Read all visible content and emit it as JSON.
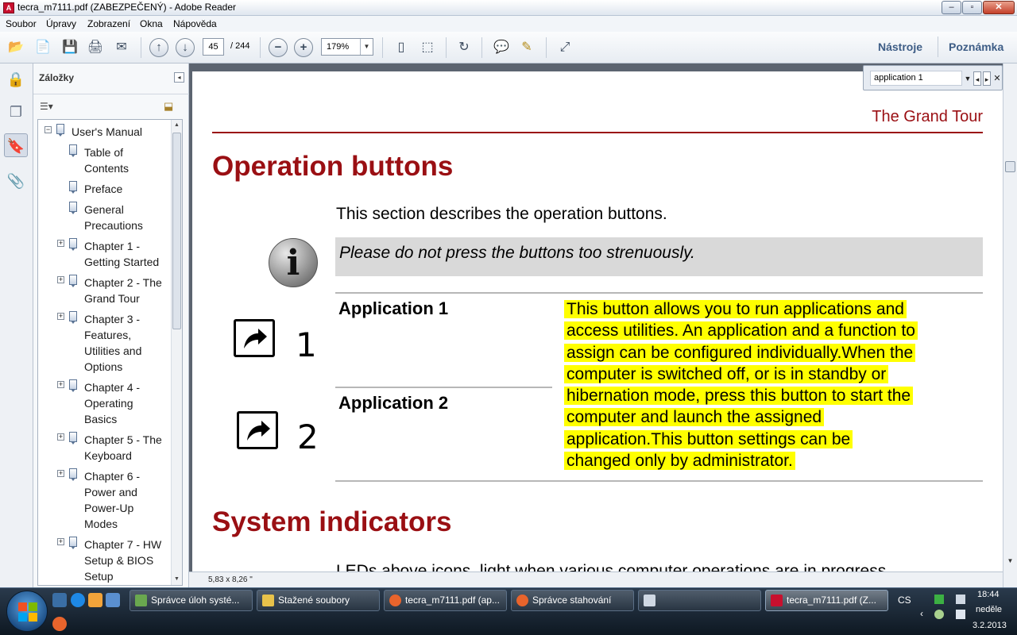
{
  "window": {
    "title": "tecra_m7111.pdf (ZABEZPEČENÝ) - Adobe Reader",
    "min": "–",
    "max": "▫",
    "close": "✕"
  },
  "menu": [
    "Soubor",
    "Úpravy",
    "Zobrazení",
    "Okna",
    "Nápověda"
  ],
  "toolbar": {
    "page_current": "45",
    "page_total": "/ 244",
    "zoom": "179%",
    "tools_label": "Nástroje",
    "comment_label": "Poznámka"
  },
  "bookmarks": {
    "title": "Záložky",
    "items": [
      "User's Manual",
      "Table of",
      "Contents",
      "Preface",
      "General",
      "Precautions",
      "Chapter 1 -",
      "Getting Started",
      "Chapter 2 - The",
      "Grand Tour",
      "Chapter 3 -",
      "Features,",
      "Utilities and",
      "Options",
      "Chapter 4 -",
      "Operating",
      "Basics",
      "Chapter 5 - The",
      "Keyboard",
      "Chapter 6 -",
      "Power and",
      "Power-Up",
      "Modes",
      "Chapter 7 - HW",
      "Setup & BIOS",
      "Setup"
    ],
    "page_size": "5,83 x 8,26 \""
  },
  "find": {
    "value": "application 1"
  },
  "document": {
    "running_head": "The Grand Tour",
    "h1": "Operation buttons",
    "intro": "This section describes the operation buttons.",
    "note": "Please do not press the buttons too strenuously.",
    "app1_label": "Application 1",
    "app2_label": "Application 2",
    "num1": "1",
    "num2": "2",
    "description_lines": [
      "This button allows you to run applications and",
      "access utilities. An application and a function to",
      "assign can be configured individually.When the",
      "computer is switched off, or is in standby or",
      "hibernation mode, press this button to start the",
      "computer and launch the assigned",
      "application.This button settings can be",
      "changed only by administrator."
    ],
    "h2": "System indicators",
    "partial_line": "LEDs above icons, light when various computer operations are in progress."
  },
  "taskbar": {
    "tasks": [
      "Správce úloh systé...",
      "Stažené soubory",
      "tecra_m7111.pdf (ap...",
      "Správce stahování",
      "",
      "tecra_m7111.pdf (Z..."
    ],
    "lang": "CS",
    "time": "18:44",
    "day": "neděle",
    "date": "3.2.2013"
  },
  "colors": {
    "heading_red": "#9a0f13",
    "highlight": "#ffff00"
  }
}
